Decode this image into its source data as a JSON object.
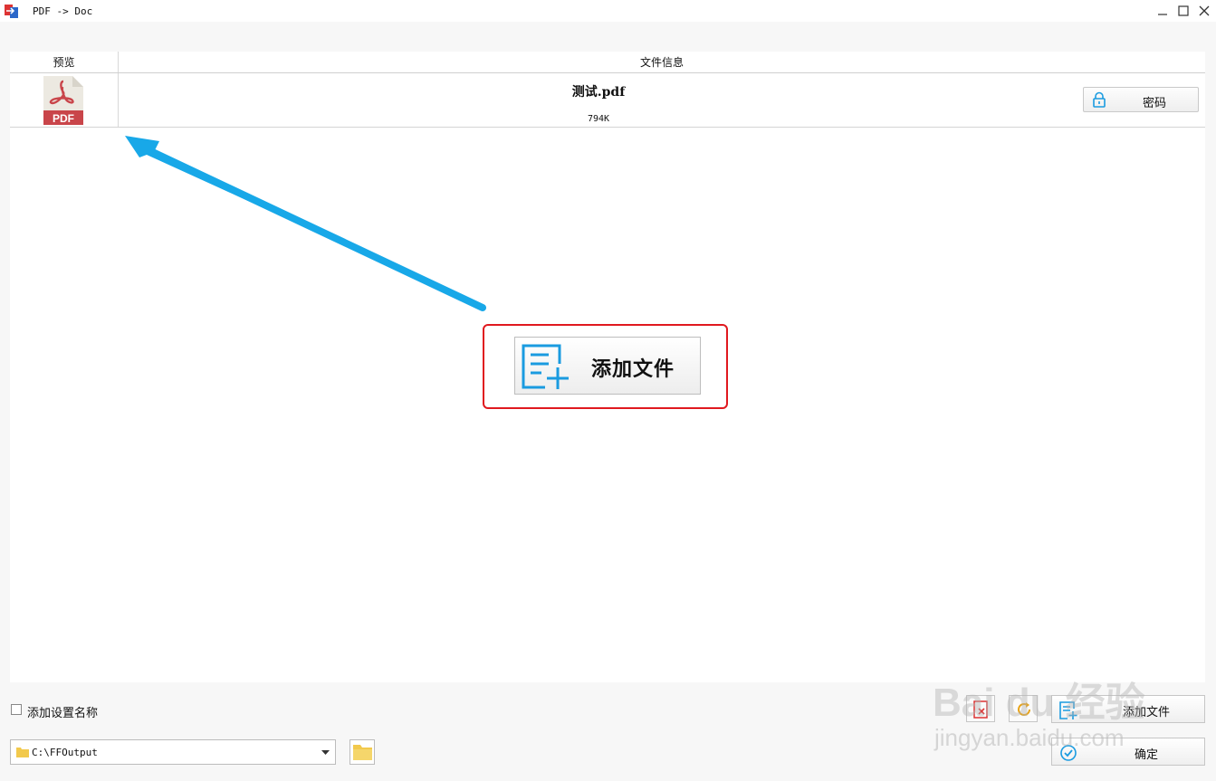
{
  "window": {
    "title": "PDF -> Doc"
  },
  "table": {
    "col_preview": "预览",
    "col_info": "文件信息",
    "rows": [
      {
        "thumb_label": "PDF",
        "filename": "测试.pdf",
        "size": "794K",
        "password_label": "密码"
      }
    ]
  },
  "center": {
    "add_file_label": "添加文件"
  },
  "footer": {
    "checkbox_label": "添加设置名称",
    "output_path": "C:\\FFOutput",
    "add_file_label": "添加文件",
    "confirm_label": "确定"
  },
  "watermark": {
    "brand": "Bai du 经验",
    "url": "jingyan.baidu.com"
  },
  "colors": {
    "accent_blue": "#1a9be0",
    "highlight_red": "#e0191f",
    "pdf_red": "#c9454a",
    "arrow_blue": "#18a8e8"
  }
}
